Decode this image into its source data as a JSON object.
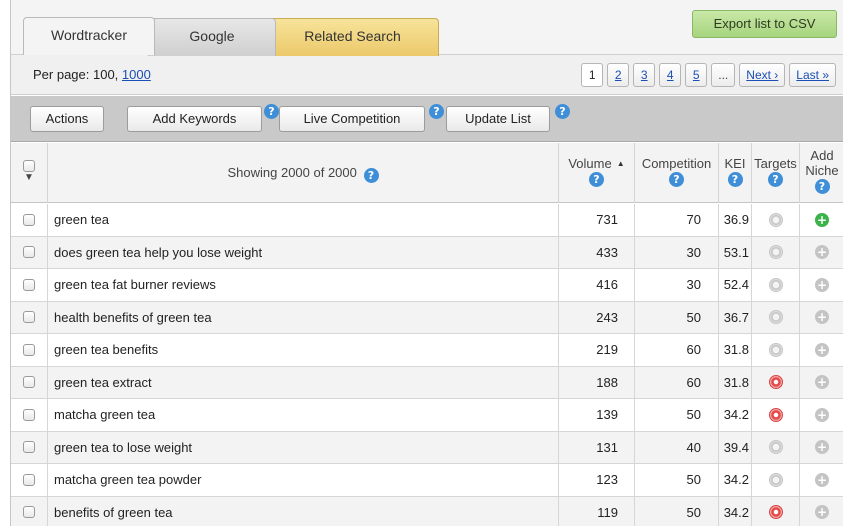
{
  "tabs": [
    {
      "label": "Wordtracker"
    },
    {
      "label": "Google"
    },
    {
      "label": "Related Search"
    }
  ],
  "export_label": "Export list to CSV",
  "perpage": {
    "prefix": "Per page: 100, ",
    "link": "1000"
  },
  "pager": [
    "1",
    "2",
    "3",
    "4",
    "5",
    "...",
    "Next ›",
    "Last »"
  ],
  "toolbar": {
    "actions": "Actions",
    "add_keywords": "Add Keywords",
    "live_competition": "Live Competition",
    "update_list": "Update List",
    "help_glyph": "?"
  },
  "table": {
    "showing": "Showing 2000 of 2000",
    "col_volume": "Volume",
    "col_competition": "Competition",
    "col_kei": "KEI",
    "col_targets": "Targets",
    "col_add": "Add",
    "col_niche": "Niche",
    "rows": [
      {
        "keyword": "green tea",
        "volume": "731",
        "competition": "70",
        "kei": "36.9",
        "target": "gray",
        "niche": "green"
      },
      {
        "keyword": "does green tea help you lose weight",
        "volume": "433",
        "competition": "30",
        "kei": "53.1",
        "target": "gray",
        "niche": "gray"
      },
      {
        "keyword": "green tea fat burner reviews",
        "volume": "416",
        "competition": "30",
        "kei": "52.4",
        "target": "gray",
        "niche": "gray"
      },
      {
        "keyword": "health benefits of green tea",
        "volume": "243",
        "competition": "50",
        "kei": "36.7",
        "target": "gray",
        "niche": "gray"
      },
      {
        "keyword": "green tea benefits",
        "volume": "219",
        "competition": "60",
        "kei": "31.8",
        "target": "gray",
        "niche": "gray"
      },
      {
        "keyword": "green tea extract",
        "volume": "188",
        "competition": "60",
        "kei": "31.8",
        "target": "red",
        "niche": "gray"
      },
      {
        "keyword": "matcha green tea",
        "volume": "139",
        "competition": "50",
        "kei": "34.2",
        "target": "red",
        "niche": "gray"
      },
      {
        "keyword": "green tea to lose weight",
        "volume": "131",
        "competition": "40",
        "kei": "39.4",
        "target": "gray",
        "niche": "gray"
      },
      {
        "keyword": "matcha green tea powder",
        "volume": "123",
        "competition": "50",
        "kei": "34.2",
        "target": "gray",
        "niche": "gray"
      },
      {
        "keyword": "benefits of green tea",
        "volume": "119",
        "competition": "50",
        "kei": "34.2",
        "target": "red",
        "niche": "gray"
      }
    ]
  },
  "colors": {
    "tab_related": "#ecc96b",
    "export": "#a6d47d",
    "help": "#3f8fd8",
    "target_red": "#e44b4b",
    "niche_green": "#3bb34a"
  }
}
